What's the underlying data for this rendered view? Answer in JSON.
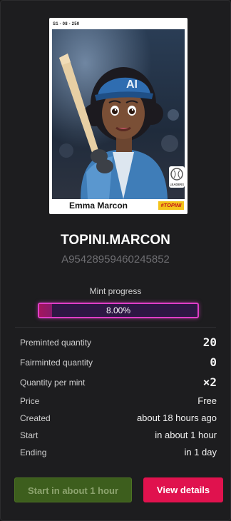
{
  "card_image": {
    "serial": "S1 - 08 - 250",
    "player_name": "Emma Marcon",
    "brand_tag": "#TOPINI",
    "cap_text": "AI",
    "badge_text": "LEADERS"
  },
  "title": "TOPINI.MARCON",
  "subtitle": "A95428959460245852",
  "mint": {
    "label": "Mint progress",
    "percent_text": "8.00%",
    "progress": 0.08
  },
  "stats": [
    {
      "label": "Preminted quantity",
      "value": "20"
    },
    {
      "label": "Fairminted quantity",
      "value": "0"
    },
    {
      "label": "Quantity per mint",
      "value": "×2"
    },
    {
      "label": "Price",
      "value": "Free"
    },
    {
      "label": "Created",
      "value": "about 18 hours ago"
    },
    {
      "label": "Start",
      "value": "in about 1 hour"
    },
    {
      "label": "Ending",
      "value": "in 1 day"
    }
  ],
  "buttons": {
    "start": "Start in about 1 hour",
    "details": "View details"
  },
  "colors": {
    "accent": "#e0124e",
    "progress_border": "#e13ec8",
    "start_button": "#3d5e1d"
  }
}
